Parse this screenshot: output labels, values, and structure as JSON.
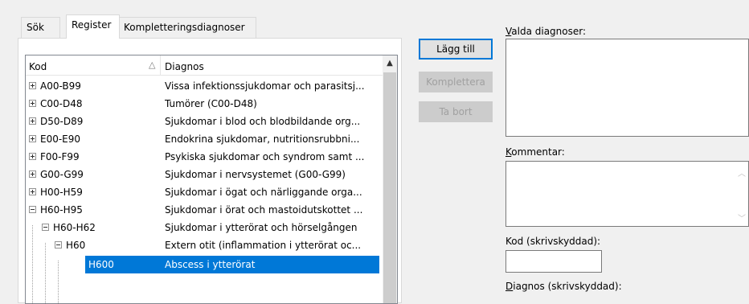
{
  "tabs": [
    {
      "label": "Sök",
      "active": false
    },
    {
      "label": "Register",
      "active": true
    },
    {
      "label": "Kompletteringsdiagnoser",
      "active": false
    }
  ],
  "tree": {
    "columns": {
      "kod": "Kod",
      "diagnos": "Diagnos"
    },
    "rows": [
      {
        "code": "A00-B99",
        "desc": "Vissa infektionssjukdomar och parasitsj..."
      },
      {
        "code": "C00-D48",
        "desc": "Tumörer (C00-D48)"
      },
      {
        "code": "D50-D89",
        "desc": "Sjukdomar i blod och blodbildande org..."
      },
      {
        "code": "E00-E90",
        "desc": "Endokrina sjukdomar, nutritionsrubbni..."
      },
      {
        "code": "F00-F99",
        "desc": "Psykiska sjukdomar och syndrom samt ..."
      },
      {
        "code": "G00-G99",
        "desc": "Sjukdomar i nervsystemet (G00-G99)"
      },
      {
        "code": "H00-H59",
        "desc": "Sjukdomar i ögat och närliggande orga..."
      },
      {
        "code": "H60-H95",
        "desc": "Sjukdomar i örat och mastoidutskottet ..."
      },
      {
        "code": "H60-H62",
        "desc": "Sjukdomar i ytterörat och hörselgången"
      },
      {
        "code": "H60",
        "desc": "Extern otit (inflammation i ytterörat oc..."
      },
      {
        "code": "H600",
        "desc": "Abscess i ytterörat"
      }
    ]
  },
  "buttons": {
    "add": "Lägg till",
    "complete": "Komplettera",
    "remove": "Ta bort"
  },
  "right": {
    "selected_label_first": "V",
    "selected_label_rest": "alda diagnoser:",
    "comment_label_first": "K",
    "comment_label_rest": "ommentar:",
    "code_label": "Kod (skrivskyddad):",
    "diag_label_first": "D",
    "diag_label_rest": "iagnos (skrivskyddad):"
  },
  "colors": {
    "selection": "#0078d7",
    "default_button_border": "#0078d7"
  }
}
